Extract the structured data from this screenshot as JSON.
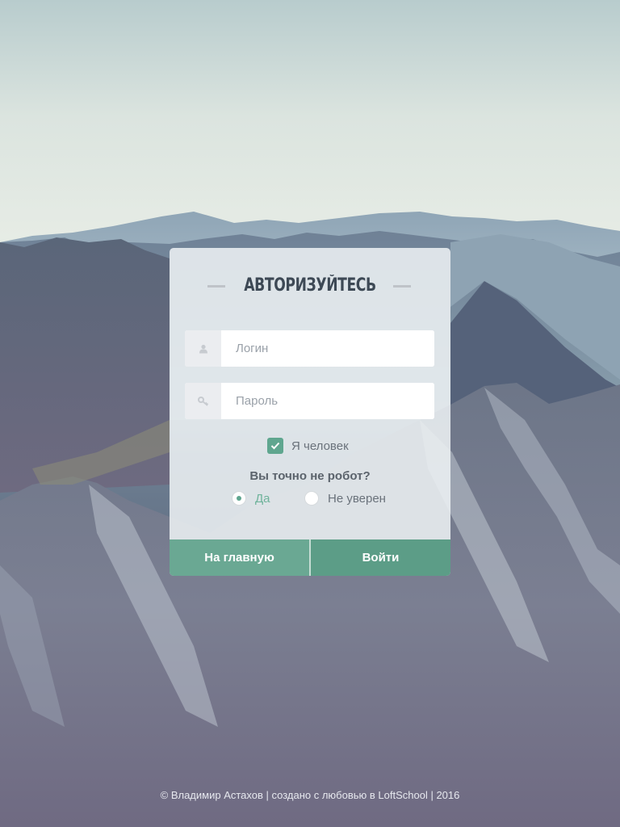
{
  "card": {
    "title": "АВТОРИЗУЙТЕСЬ"
  },
  "login": {
    "placeholder": "Логин",
    "icon": "user-icon"
  },
  "password": {
    "placeholder": "Пароль",
    "icon": "key-icon"
  },
  "human_check": {
    "label": "Я человек",
    "checked": true
  },
  "robot_question": {
    "text": "Вы точно не робот?",
    "options": [
      {
        "label": "Да",
        "selected": true
      },
      {
        "label": "Не уверен",
        "selected": false
      }
    ]
  },
  "buttons": {
    "home_label": "На главную",
    "login_label": "Войти"
  },
  "footer": {
    "text": "© Владимир Астахов | создано с любовью в LoftSchool | 2016"
  },
  "colors": {
    "accent": "#5fa68f",
    "button_home": "#6aa893",
    "button_login": "#5c9d87",
    "title": "#3d4955"
  }
}
